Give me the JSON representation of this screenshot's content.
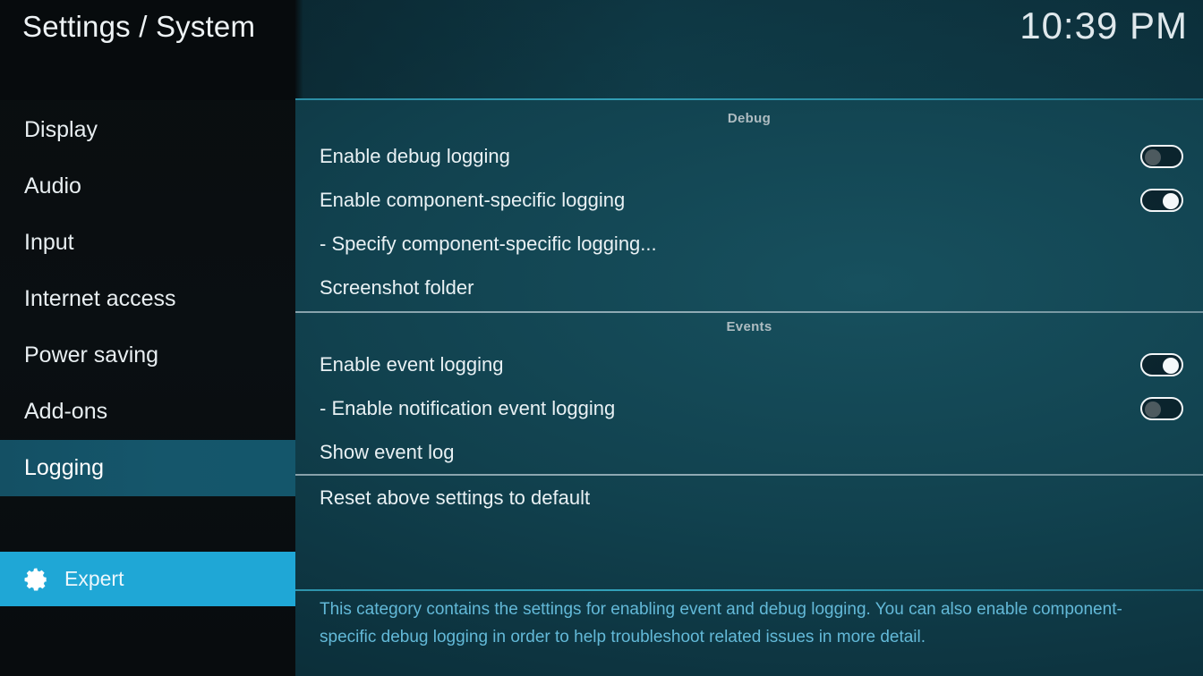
{
  "header": {
    "title": "Settings / System",
    "clock": "10:39 PM"
  },
  "sidebar": {
    "items": [
      {
        "label": "Display",
        "selected": false
      },
      {
        "label": "Audio",
        "selected": false
      },
      {
        "label": "Input",
        "selected": false
      },
      {
        "label": "Internet access",
        "selected": false
      },
      {
        "label": "Power saving",
        "selected": false
      },
      {
        "label": "Add-ons",
        "selected": false
      },
      {
        "label": "Logging",
        "selected": true
      }
    ],
    "level_button": {
      "label": "Expert",
      "icon": "gear-icon",
      "background_color": "#1fa7d6"
    }
  },
  "main": {
    "groups": [
      {
        "title": "Debug",
        "rows": [
          {
            "label": "Enable debug logging",
            "control": "toggle",
            "value": "off"
          },
          {
            "label": "Enable component-specific logging",
            "control": "toggle",
            "value": "on"
          },
          {
            "label": "- Specify component-specific logging...",
            "control": "none",
            "value": ""
          },
          {
            "label": "Screenshot folder",
            "control": "none",
            "value": ""
          }
        ]
      },
      {
        "title": "Events",
        "rows": [
          {
            "label": "Enable event logging",
            "control": "toggle",
            "value": "on"
          },
          {
            "label": "- Enable notification event logging",
            "control": "toggle",
            "value": "off"
          },
          {
            "label": "Show event log",
            "control": "none",
            "value": ""
          }
        ]
      },
      {
        "title": "",
        "rows": [
          {
            "label": "Reset above settings to default",
            "control": "none",
            "value": ""
          }
        ]
      }
    ]
  },
  "description": "This category contains the settings for enabling event and debug logging. You can also enable component-specific debug logging in order to help troubleshoot related issues in more detail.",
  "colors": {
    "accent": "#1fa7d6",
    "selection": "#15566b",
    "description_text": "#63b9d8",
    "rule": "#33a3bb"
  }
}
